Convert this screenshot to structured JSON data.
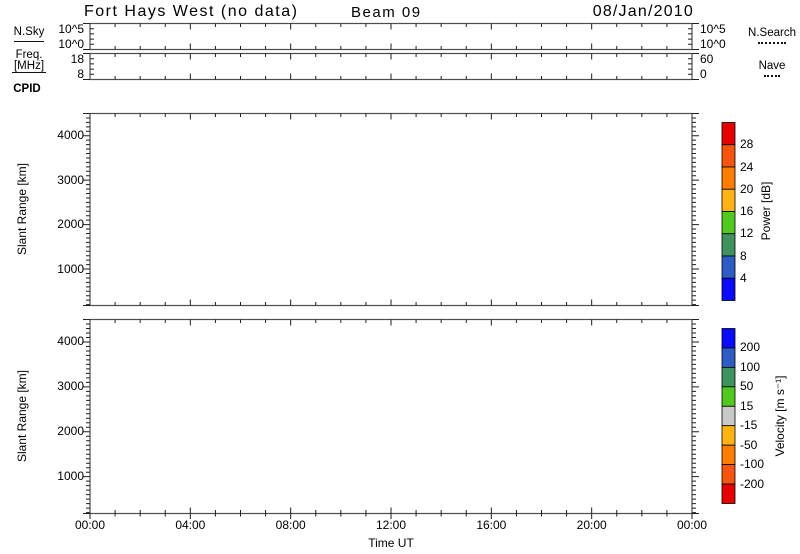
{
  "header": {
    "title": "Fort Hays West (no data)",
    "beam": "Beam 09",
    "date": "08/Jan/2010"
  },
  "left_column": {
    "nsky": "N.Sky",
    "freq_line1": "Freq.",
    "freq_line2": "[MHz]",
    "cpid": "CPID"
  },
  "right_column": {
    "nsearch": "N.Search",
    "nave": "Nave"
  },
  "strips": [
    {
      "name": "noise",
      "left_ticks": [
        "10^5",
        "10^0"
      ],
      "right_ticks": [
        "10^5",
        "10^0"
      ]
    },
    {
      "name": "freq-nave",
      "left_ticks": [
        "18",
        "8"
      ],
      "right_ticks": [
        "60",
        "0"
      ]
    }
  ],
  "panels": [
    {
      "name": "power",
      "ylabel": "Slant Range [km]",
      "yticks": [
        4000,
        3000,
        2000,
        1000
      ]
    },
    {
      "name": "velocity",
      "ylabel": "Slant Range [km]",
      "yticks": [
        4000,
        3000,
        2000,
        1000
      ]
    }
  ],
  "xaxis": {
    "label": "Time UT",
    "hours": [
      0,
      4,
      8,
      12,
      16,
      20,
      24
    ],
    "ticks": [
      "00:00",
      "04:00",
      "08:00",
      "12:00",
      "16:00",
      "20:00",
      "00:00"
    ]
  },
  "colorbars": [
    {
      "name": "power",
      "label": "Power [dB]",
      "ticks": [
        "28",
        "24",
        "20",
        "16",
        "12",
        "8",
        "4"
      ],
      "colors": [
        "#e60000",
        "#f5550f",
        "#ff7d00",
        "#ffb414",
        "#50c81e",
        "#3f915f",
        "#2e5cc5",
        "#0a0aff"
      ]
    },
    {
      "name": "velocity",
      "label": "Velocity [m s⁻¹]",
      "ticks": [
        "200",
        "100",
        "50",
        "15",
        "-15",
        "-50",
        "-100",
        "-200"
      ],
      "colors": [
        "#0a0aff",
        "#2e5cc5",
        "#3f915f",
        "#50c81e",
        "#c8c8c8",
        "#ffb414",
        "#ff7d00",
        "#f5550f",
        "#e60000"
      ]
    }
  ],
  "chart_data": [
    {
      "type": "line",
      "panel": "noise",
      "x_hours_range": [
        0,
        24
      ],
      "yticks": [
        "10^0",
        "10^5"
      ],
      "series": [
        {
          "name": "N.Sky",
          "linestyle": "solid",
          "values": []
        },
        {
          "name": "N.Search",
          "linestyle": "dotted",
          "values": []
        }
      ],
      "note_from_title": "no data"
    },
    {
      "type": "line",
      "panel": "freq-nave",
      "x_hours_range": [
        0,
        24
      ],
      "yticks_left": [
        8,
        18
      ],
      "yticks_right": [
        0,
        60
      ],
      "series": [
        {
          "name": "Freq. [MHz]",
          "linestyle": "solid",
          "values": []
        },
        {
          "name": "Nave",
          "linestyle": "dotted",
          "values": []
        }
      ],
      "note_from_title": "no data"
    },
    {
      "type": "heatmap",
      "panel": "power",
      "title": "Power [dB]",
      "xlabel": "Time UT",
      "ylabel": "Slant Range [km]",
      "x_hours_range": [
        0,
        24
      ],
      "ylim": [
        180,
        4500
      ],
      "yticks": [
        1000,
        2000,
        3000,
        4000
      ],
      "colorbar_bounds": [
        4,
        8,
        12,
        16,
        20,
        24,
        28
      ],
      "values": []
    },
    {
      "type": "heatmap",
      "panel": "velocity",
      "title": "Velocity [m s⁻¹]",
      "xlabel": "Time UT",
      "ylabel": "Slant Range [km]",
      "x_hours_range": [
        0,
        24
      ],
      "ylim": [
        180,
        4500
      ],
      "yticks": [
        1000,
        2000,
        3000,
        4000
      ],
      "colorbar_bounds": [
        -200,
        -100,
        -50,
        -15,
        15,
        50,
        100,
        200
      ],
      "values": []
    }
  ]
}
